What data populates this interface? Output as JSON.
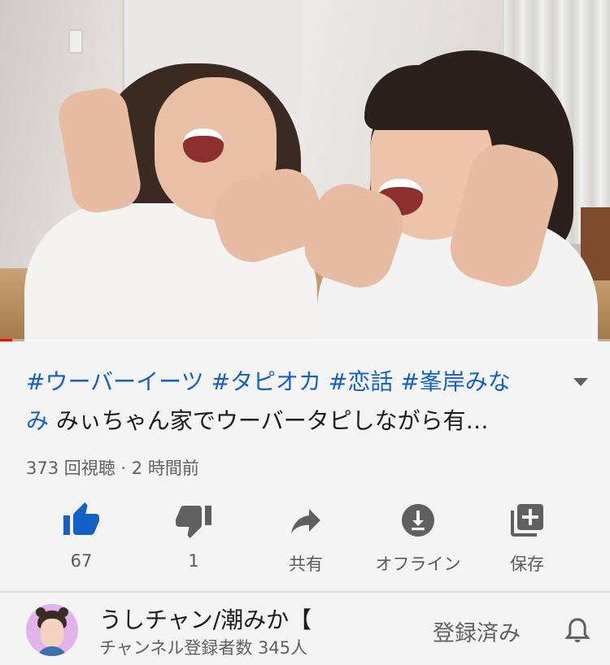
{
  "video": {
    "progress": 0.02,
    "progress_color": "#ff0000"
  },
  "title": {
    "hashtags": [
      "#ウーバーイーツ",
      "#タピオカ",
      "#恋話",
      "#峯岸みな"
    ],
    "hashtag_wrap": "み",
    "rest": " みぃちゃん家でウーバータピしながら有…"
  },
  "meta": {
    "text": "373 回視聴 · 2 時間前"
  },
  "actions": [
    {
      "icon": "thumbs-up-icon",
      "label": "67",
      "color": "#1560c4"
    },
    {
      "icon": "thumbs-down-icon",
      "label": "1",
      "color": "#606060"
    },
    {
      "icon": "share-icon",
      "label": "共有",
      "color": "#606060"
    },
    {
      "icon": "download-icon",
      "label": "オフライン",
      "color": "#606060"
    },
    {
      "icon": "save-to-playlist-icon",
      "label": "保存",
      "color": "#606060"
    }
  ],
  "channel": {
    "name": "うしチャン/潮みか【",
    "subscribers": "チャンネル登録者数 345人",
    "subscribe_state": "登録済み",
    "icon": "bell-icon"
  },
  "colors": {
    "hashtag": "#1560c4",
    "background": "#f4f4f4"
  }
}
